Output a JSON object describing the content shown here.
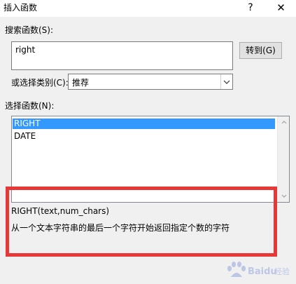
{
  "window": {
    "title": "插入函数",
    "help_label": "?",
    "close_label": "✕"
  },
  "search": {
    "label": "搜索函数(S):",
    "value": "right",
    "go_button": "转到(G)"
  },
  "category": {
    "label": "或选择类别(C):",
    "selected": "推荐"
  },
  "functions": {
    "label": "选择函数(N):",
    "items": [
      "RIGHT",
      "DATE"
    ],
    "selected_index": 0
  },
  "description": {
    "signature": "RIGHT(text,num_chars)",
    "text": "从一个文本字符串的最后一个字符开始返回指定个数的字符"
  },
  "watermark": {
    "brand": "Baidu",
    "suffix": "经验"
  },
  "colors": {
    "selection": "#3399ff",
    "highlight_border": "#e83737",
    "dialog_background": "#f0f0f0"
  }
}
